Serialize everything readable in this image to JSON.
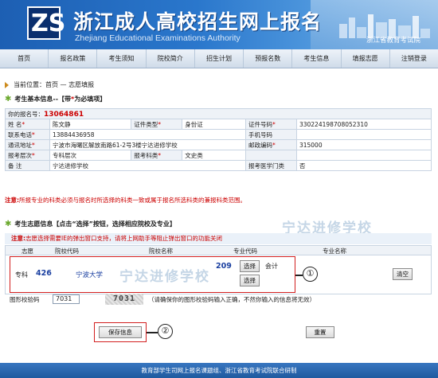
{
  "header": {
    "title": "浙江成人高校招生网上报名",
    "subtitle": "Zhejiang Educational Examinations Authority",
    "authority": "浙江省教育考试院",
    "logo_glyph": "ZS"
  },
  "nav": [
    "首页",
    "报名政策",
    "考生须知",
    "院校简介",
    "招生计划",
    "预报名数",
    "考生信息",
    "填报志愿",
    "注销登录"
  ],
  "breadcrumb": "当前位置：首页 — 志愿填报",
  "basic_section": {
    "title": "考生基本信息--【带",
    "req_mark": "*",
    "title_suffix": "为必填项】"
  },
  "info": {
    "reg_label": "你的报名号：",
    "reg_number": "13064861",
    "name_label": "姓 名",
    "name_value": "陈文静",
    "id_type_label": "证件类型",
    "id_type_value": "身份证",
    "id_no_label": "证件号码",
    "id_no_value": "330224198708052310",
    "phone_label": "联系电话",
    "phone_value": "13884436958",
    "mobile_label": "手机号码",
    "mobile_value": "",
    "address_label": "通讯地址",
    "address_value": "宁波市海曙区解放南路61-2号3楼宁达进修学校",
    "postcode_label": "邮政编码",
    "postcode_value": "315000",
    "level_label": "报考层次",
    "level_value": "专科层次",
    "subject_label": "报考科类",
    "subject_value": "文史类",
    "remark_label": "备 注",
    "remark_value": "宁达进修学校",
    "medical_label": "报考医学门类",
    "medical_value": "否"
  },
  "hint": {
    "prefix": "注意:",
    "text": "所报专业的科类必须与报名时所选择的科类一致或属于报名所选科类的兼报科类范围。"
  },
  "choice_section": {
    "title": "考生志愿信息【点击“选择”按钮，选择相应院校及专业】",
    "note_prefix": "注意:",
    "note": "志愿选择需要IE的弹出窗口支持，请将上网助手等阻止弹出窗口的功能关闭"
  },
  "choice_table": {
    "headers": [
      "志愿",
      "院校代码",
      "院校名称",
      "专业代码",
      "专业名称"
    ],
    "row_label": "专科",
    "school_code": "426",
    "school_name": "宁波大学",
    "major_code": "209",
    "major_name": "会计",
    "select_label": "选择",
    "clear_label": "清空"
  },
  "captcha": {
    "label": "图形校验码",
    "value": "7031",
    "image_text": "7031",
    "hint": "（请确保你的图形校验码输入正确，不然你输入的信息将无效）"
  },
  "actions": {
    "save": "保存信息",
    "reset": "重置"
  },
  "annotations": {
    "circle_1": "①",
    "circle_2": "②"
  },
  "watermark": "宁达进修学校",
  "footer": "教育部学生司网上报名课题组、浙江省教育考试院联合研制"
}
